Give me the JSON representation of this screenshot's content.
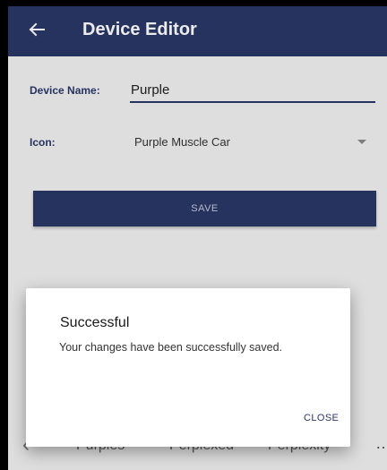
{
  "app_bar": {
    "title": "Device Editor",
    "back_icon": "arrow-left-icon"
  },
  "form": {
    "name_label": "Device Name:",
    "name_value": "Purple",
    "icon_label": "Icon:",
    "icon_value": "Purple Muscle Car",
    "save_label": "SAVE"
  },
  "suggestions": {
    "items": [
      "Purples",
      "Perplexed",
      "Perplexity"
    ],
    "back_icon": "chevron-left-icon",
    "more_icon": "more-icon"
  },
  "dialog": {
    "title": "Successful",
    "message": "Your changes have been successfully saved.",
    "close_label": "CLOSE"
  },
  "colors": {
    "primary": "#2b3868",
    "background": "#f1f1f1",
    "dialog_bg": "#ffffff"
  }
}
